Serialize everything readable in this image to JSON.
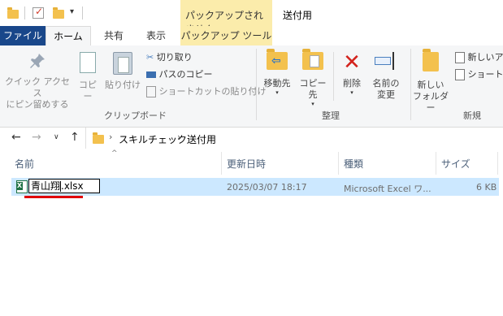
{
  "window": {
    "title": "送付用",
    "contextual_tab_header": "パックアップされません"
  },
  "tabs": {
    "file": "ファイル",
    "home": "ホーム",
    "share": "共有",
    "view": "表示",
    "tool": "パックアップ ツール"
  },
  "ribbon": {
    "pin_label_1": "クイック アクセス",
    "pin_label_2": "にピン留めする",
    "copy": "コピー",
    "paste": "貼り付け",
    "cut": "切り取り",
    "copy_path": "パスのコピー",
    "paste_shortcut": "ショートカットの貼り付け",
    "clipboard_group": "クリップボード",
    "move_to": "移動先",
    "copy_to": "コピー先",
    "delete": "削除",
    "rename_1": "名前の",
    "rename_2": "変更",
    "organize_group": "整理",
    "new_folder_1": "新しい",
    "new_folder_2": "フォルダー",
    "new_item": "新しいア",
    "shortcut": "ショートカ",
    "new_group": "新規"
  },
  "address": {
    "crumb_1": "スキルチェック",
    "crumb_2": "送付用"
  },
  "columns": {
    "name": "名前",
    "modified": "更新日時",
    "type": "種類",
    "size": "サイズ"
  },
  "file_row": {
    "name_selected": "青山翔",
    "name_rest": ".xlsx",
    "modified": "2025/03/07 18:17",
    "type": "Microsoft Excel ワ...",
    "size": "6 KB"
  },
  "colors": {
    "file_tab": "#19478a",
    "contextual": "#fbecab",
    "selection": "#cce8ff",
    "annotation_underline": "#e00000"
  }
}
